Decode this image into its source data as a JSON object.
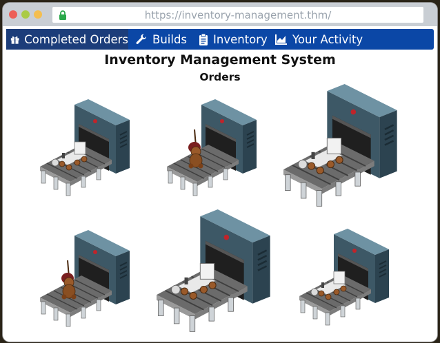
{
  "browser": {
    "url": "https://inventory-management.thm/",
    "lock_icon": "lock-icon",
    "window_controls": [
      "close",
      "minimize",
      "maximize"
    ]
  },
  "nav": {
    "items": [
      {
        "icon": "gift-icon",
        "label": "Completed Orders",
        "active": true
      },
      {
        "icon": "wrench-icon",
        "label": "Builds",
        "active": false
      },
      {
        "icon": "clipboard-icon",
        "label": "Inventory",
        "active": false
      },
      {
        "icon": "chart-icon",
        "label": "Your Activity",
        "active": false
      }
    ]
  },
  "page": {
    "title": "Inventory Management System",
    "subtitle": "Orders"
  },
  "orders": [
    {
      "machine": "factory-machine",
      "product": "toy-train"
    },
    {
      "machine": "factory-machine",
      "product": "teddy-bear"
    },
    {
      "machine": "factory-machine",
      "product": "toy-train"
    },
    {
      "machine": "factory-machine",
      "product": "teddy-bear"
    },
    {
      "machine": "factory-machine",
      "product": "toy-train"
    },
    {
      "machine": "factory-machine",
      "product": "toy-train"
    }
  ],
  "colors": {
    "nav_bg": "#0b47a6",
    "nav_active": "#1c3d7a",
    "machine_front": "#3d5866",
    "machine_side": "#2c4350",
    "machine_top": "#5b7c8c",
    "conveyor": "#5d5d5d"
  }
}
